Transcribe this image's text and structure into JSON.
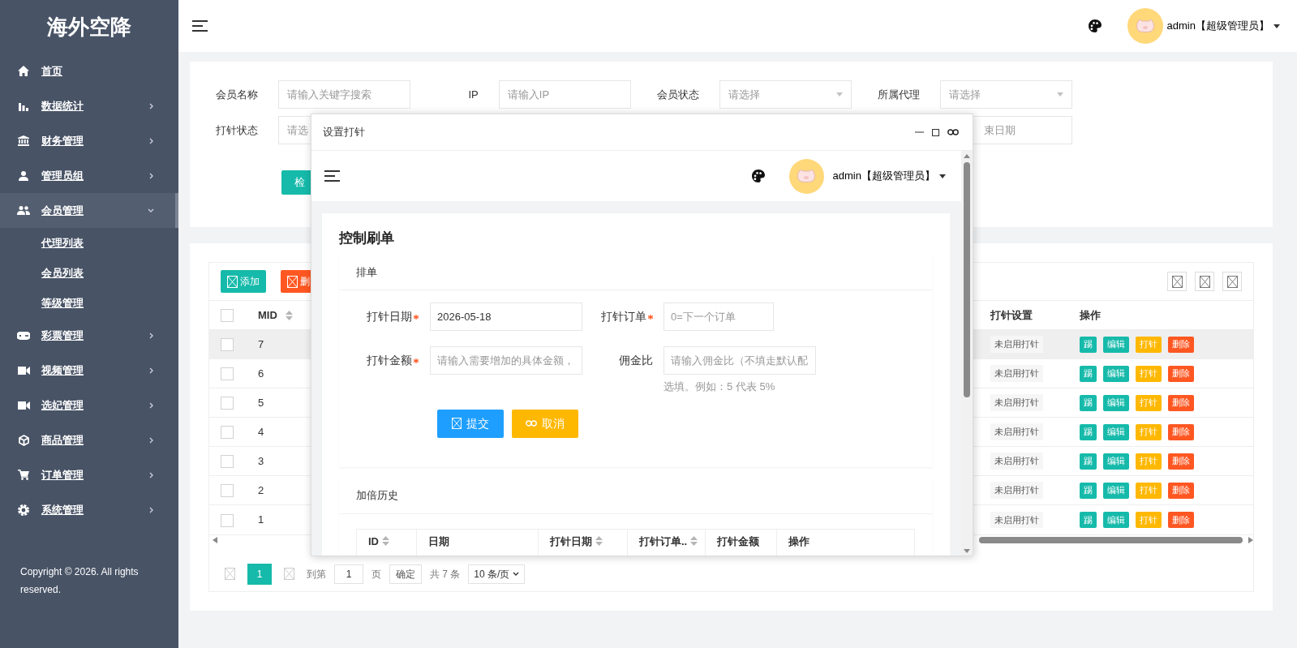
{
  "sidebar": {
    "logo": "海外空降",
    "items": [
      {
        "label": "首页"
      },
      {
        "label": "数据统计",
        "expanded": false
      },
      {
        "label": "财务管理",
        "expanded": false
      },
      {
        "label": "管理员组",
        "expanded": false
      },
      {
        "label": "会员管理",
        "expanded": true,
        "children": [
          {
            "label": "代理列表"
          },
          {
            "label": "会员列表"
          },
          {
            "label": "等级管理"
          }
        ]
      },
      {
        "label": "彩票管理",
        "expanded": false
      },
      {
        "label": "视频管理",
        "expanded": false
      },
      {
        "label": "选妃管理",
        "expanded": false
      },
      {
        "label": "商品管理",
        "expanded": false
      },
      {
        "label": "订单管理",
        "expanded": false
      },
      {
        "label": "系统管理",
        "expanded": false
      }
    ],
    "copyright": "Copyright © 2026. All rights reserved."
  },
  "header": {
    "user": "admin【超级管理员】"
  },
  "filters": [
    {
      "kind": "input",
      "label": "会员名称",
      "placeholder": "请输入关键字搜索"
    },
    {
      "kind": "input",
      "label": "IP",
      "placeholder": "请输入IP"
    },
    {
      "kind": "select",
      "label": "会员状态",
      "placeholder": "请选择"
    },
    {
      "kind": "select",
      "label": "所属代理",
      "placeholder": "请选择"
    },
    {
      "kind": "select",
      "label": "打针状态",
      "placeholder": "请选"
    },
    {
      "kind": "date",
      "placeholder": "束日期"
    }
  ],
  "search_button": "检",
  "toolbar": {
    "buttons": [
      {
        "label": "添加",
        "color": "#16baaa"
      },
      {
        "label": "删",
        "color": "#ff5722"
      }
    ]
  },
  "table": {
    "select_all_checked": false,
    "columns": [
      {
        "label": "MID",
        "sortable": true
      },
      {
        "label": "打针设置",
        "sortable": false
      },
      {
        "label": "操作",
        "sortable": false
      }
    ],
    "rows": [
      {
        "checked": false,
        "hovered": true,
        "mid": "7",
        "punch_setting": "未启用打针",
        "actions": [
          {
            "label": "踢",
            "color": "#16baaa"
          },
          {
            "label": "编辑",
            "color": "#16baaa"
          },
          {
            "label": "打针",
            "color": "#ffb800"
          },
          {
            "label": "删除",
            "color": "#ff5722"
          }
        ]
      },
      {
        "checked": false,
        "hovered": false,
        "mid": "6",
        "punch_setting": "未启用打针",
        "actions": [
          {
            "label": "踢",
            "color": "#16baaa"
          },
          {
            "label": "编辑",
            "color": "#16baaa"
          },
          {
            "label": "打针",
            "color": "#ffb800"
          },
          {
            "label": "删除",
            "color": "#ff5722"
          }
        ]
      },
      {
        "checked": false,
        "hovered": false,
        "mid": "5",
        "punch_setting": "未启用打针",
        "actions": [
          {
            "label": "踢",
            "color": "#16baaa"
          },
          {
            "label": "编辑",
            "color": "#16baaa"
          },
          {
            "label": "打针",
            "color": "#ffb800"
          },
          {
            "label": "删除",
            "color": "#ff5722"
          }
        ]
      },
      {
        "checked": false,
        "hovered": false,
        "mid": "4",
        "punch_setting": "未启用打针",
        "actions": [
          {
            "label": "踢",
            "color": "#16baaa"
          },
          {
            "label": "编辑",
            "color": "#16baaa"
          },
          {
            "label": "打针",
            "color": "#ffb800"
          },
          {
            "label": "删除",
            "color": "#ff5722"
          }
        ]
      },
      {
        "checked": false,
        "hovered": false,
        "mid": "3",
        "punch_setting": "未启用打针",
        "actions": [
          {
            "label": "踢",
            "color": "#16baaa"
          },
          {
            "label": "编辑",
            "color": "#16baaa"
          },
          {
            "label": "打针",
            "color": "#ffb800"
          },
          {
            "label": "删除",
            "color": "#ff5722"
          }
        ]
      },
      {
        "checked": false,
        "hovered": false,
        "mid": "2",
        "punch_setting": "未启用打针",
        "actions": [
          {
            "label": "踢",
            "color": "#16baaa"
          },
          {
            "label": "编辑",
            "color": "#16baaa"
          },
          {
            "label": "打针",
            "color": "#ffb800"
          },
          {
            "label": "删除",
            "color": "#ff5722"
          }
        ]
      },
      {
        "checked": false,
        "hovered": false,
        "mid": "1",
        "punch_setting": "未启用打针",
        "actions": [
          {
            "label": "踢",
            "color": "#16baaa"
          },
          {
            "label": "编辑",
            "color": "#16baaa"
          },
          {
            "label": "打针",
            "color": "#ffb800"
          },
          {
            "label": "删除",
            "color": "#ff5722"
          }
        ]
      }
    ]
  },
  "pagination": {
    "pages": [
      {
        "label": "1",
        "selected": true
      }
    ],
    "goto_label": "到第",
    "goto_value": "1",
    "page_unit": "页",
    "confirm": "确定",
    "total": "共 7 条",
    "page_size": "10 条/页"
  },
  "dialog": {
    "title": "设置打针",
    "header_user": "admin【超级管理员】",
    "heading": "控制刷单",
    "section": "排单",
    "fields": [
      {
        "label": "打针日期",
        "required": true,
        "value": "2026-05-18"
      },
      {
        "label": "打针订单",
        "required": true,
        "placeholder": "0=下一个订单"
      },
      {
        "label": "打针金额",
        "required": true,
        "placeholder": "请输入需要增加的具体金额，"
      },
      {
        "label": "佣金比",
        "required": false,
        "placeholder": "请输入佣金比（不填走默认配",
        "help": "选填。例如：5 代表 5%"
      }
    ],
    "buttons": [
      {
        "label": "提交",
        "color": "#1e9fff"
      },
      {
        "label": "取消",
        "color": "#ffb800"
      }
    ],
    "history_title": "加倍历史",
    "history_columns": [
      {
        "label": "ID",
        "sortable": true
      },
      {
        "label": "日期",
        "sortable": false
      },
      {
        "label": "打针日期",
        "sortable": true
      },
      {
        "label": "打针订单..",
        "sortable": true
      },
      {
        "label": "打针金额",
        "sortable": false
      },
      {
        "label": "操作",
        "sortable": false
      }
    ]
  }
}
